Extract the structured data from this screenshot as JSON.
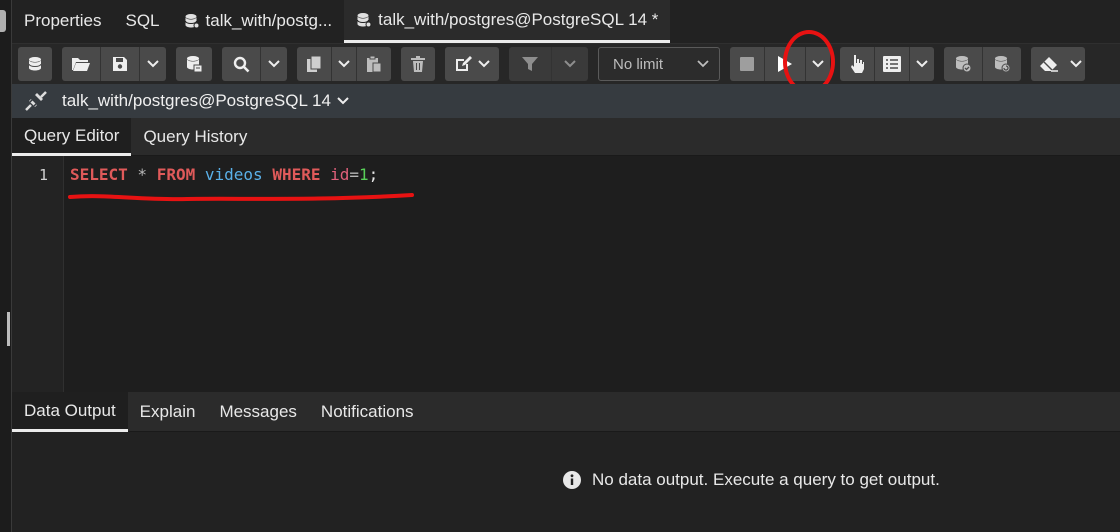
{
  "tabs": [
    {
      "label": "Properties",
      "icon": "none",
      "active": false
    },
    {
      "label": "SQL",
      "icon": "none",
      "active": false
    },
    {
      "label": "talk_with/postg...",
      "icon": "database-icon",
      "active": false
    },
    {
      "label": "talk_with/postgres@PostgreSQL 14 *",
      "icon": "database-icon",
      "active": true
    }
  ],
  "toolbar": {
    "limit_select": "No limit",
    "icons": [
      "database-icon",
      "folder-open-icon",
      "save-icon",
      "chevron-down-icon",
      "database-export-icon",
      "search-icon",
      "chevron-down-icon",
      "copy-icon",
      "chevron-down-icon",
      "paste-icon",
      "trash-icon",
      "edit-icon",
      "chevron-down-icon",
      "filter-icon",
      "chevron-down-icon",
      "stop-icon",
      "play-icon",
      "chevron-down-icon",
      "pointer-icon",
      "list-icon",
      "chevron-down-icon",
      "database-check-icon",
      "database-refresh-icon",
      "eraser-icon",
      "chevron-down-icon"
    ]
  },
  "connection": {
    "label": "talk_with/postgres@PostgreSQL 14"
  },
  "editor_tabs": [
    {
      "label": "Query Editor",
      "active": true
    },
    {
      "label": "Query History",
      "active": false
    }
  ],
  "editor": {
    "line_number": "1",
    "tokens": {
      "select": "SELECT",
      "star": " * ",
      "from": "FROM",
      "sp1": " ",
      "table": "videos",
      "sp2": " ",
      "where": "WHERE",
      "sp3": " ",
      "col": "id",
      "eq": "=",
      "val": "1",
      "semi": ";"
    }
  },
  "output_tabs": [
    {
      "label": "Data Output",
      "active": true
    },
    {
      "label": "Explain",
      "active": false
    },
    {
      "label": "Messages",
      "active": false
    },
    {
      "label": "Notifications",
      "active": false
    }
  ],
  "output": {
    "message": "No data output. Execute a query to get output."
  },
  "colors": {
    "annotation_red": "#e81212",
    "keyword": "#e05a5a",
    "table": "#5ab0e8",
    "number": "#58d058"
  }
}
